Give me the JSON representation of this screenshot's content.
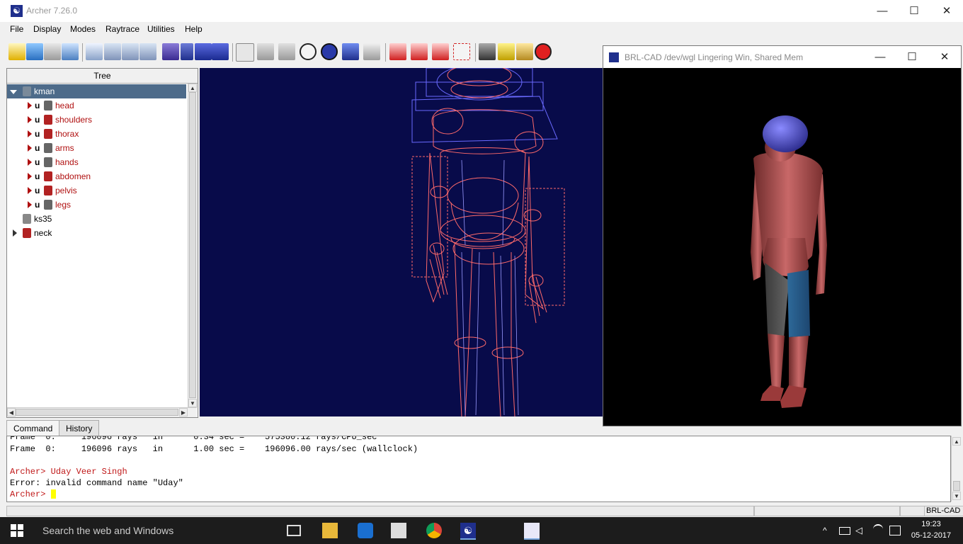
{
  "window": {
    "title": "Archer 7.26.0",
    "minimize": "—",
    "maximize": "☐",
    "close": "✕"
  },
  "menubar": {
    "items": [
      "File",
      "Display",
      "Modes",
      "Raytrace",
      "Utilities",
      "Help"
    ]
  },
  "tree": {
    "header": "Tree",
    "root": "kman",
    "children": [
      {
        "op": "u",
        "name": "head"
      },
      {
        "op": "u",
        "name": "shoulders"
      },
      {
        "op": "u",
        "name": "thorax"
      },
      {
        "op": "u",
        "name": "arms"
      },
      {
        "op": "u",
        "name": "hands"
      },
      {
        "op": "u",
        "name": "abdomen"
      },
      {
        "op": "u",
        "name": "pelvis"
      },
      {
        "op": "u",
        "name": "legs"
      }
    ],
    "others": [
      "ks35",
      "neck"
    ]
  },
  "raytrace_window": {
    "title": "BRL-CAD /dev/wgl Lingering Win, Shared Mem",
    "minimize": "—",
    "maximize": "☐",
    "close": "✕"
  },
  "command": {
    "tabs": [
      "Command",
      "History"
    ],
    "lines": [
      "Frame  0:     196096 rays   in      0.34 sec =    575380.12 rays/CPU_sec",
      "Frame  0:     196096 rays   in      1.00 sec =    196096.00 rays/sec (wallclock)"
    ],
    "prompt": "Archer>",
    "entered": "Uday Veer Singh",
    "error": "Error: invalid command name \"Uday\""
  },
  "statusbar": {
    "label": "BRL-CAD"
  },
  "taskbar": {
    "search_placeholder": "Search the web and Windows",
    "time": "19:23",
    "date": "05-12-2017"
  },
  "colors": {
    "viewport_bg": "#080b4a",
    "wireframe": "#ff6a6a",
    "wireframe_blue": "#6a6aff",
    "tree_selected": "#4d6b8a",
    "prompt_red": "#c01818"
  }
}
